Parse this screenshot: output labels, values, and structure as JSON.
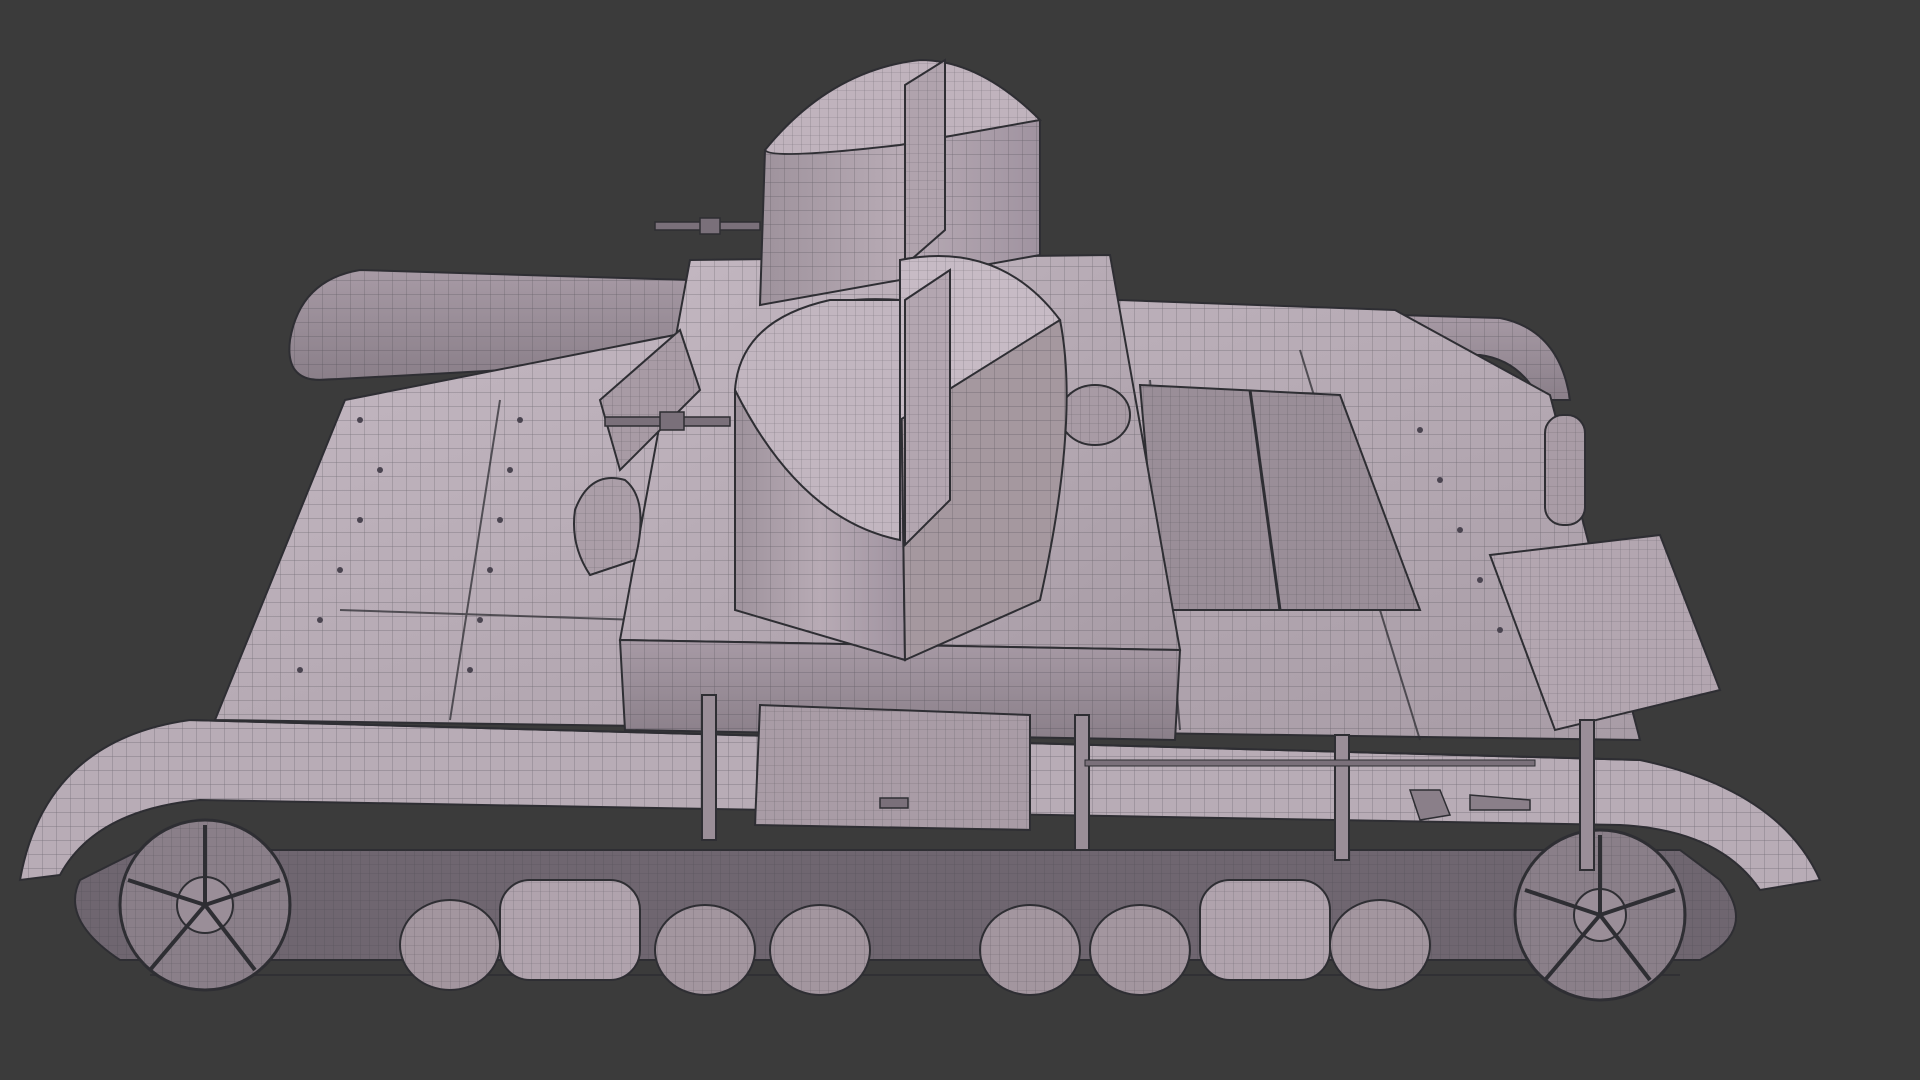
{
  "scene": {
    "subject": "twin-turret-tank-wireframe",
    "background_color": "#3b3b3b",
    "mesh_color": "#b5a8b2",
    "wire_color": "#3a3a40",
    "shadow_color": "#8f8590",
    "highlight_color": "#cfc3cc"
  }
}
